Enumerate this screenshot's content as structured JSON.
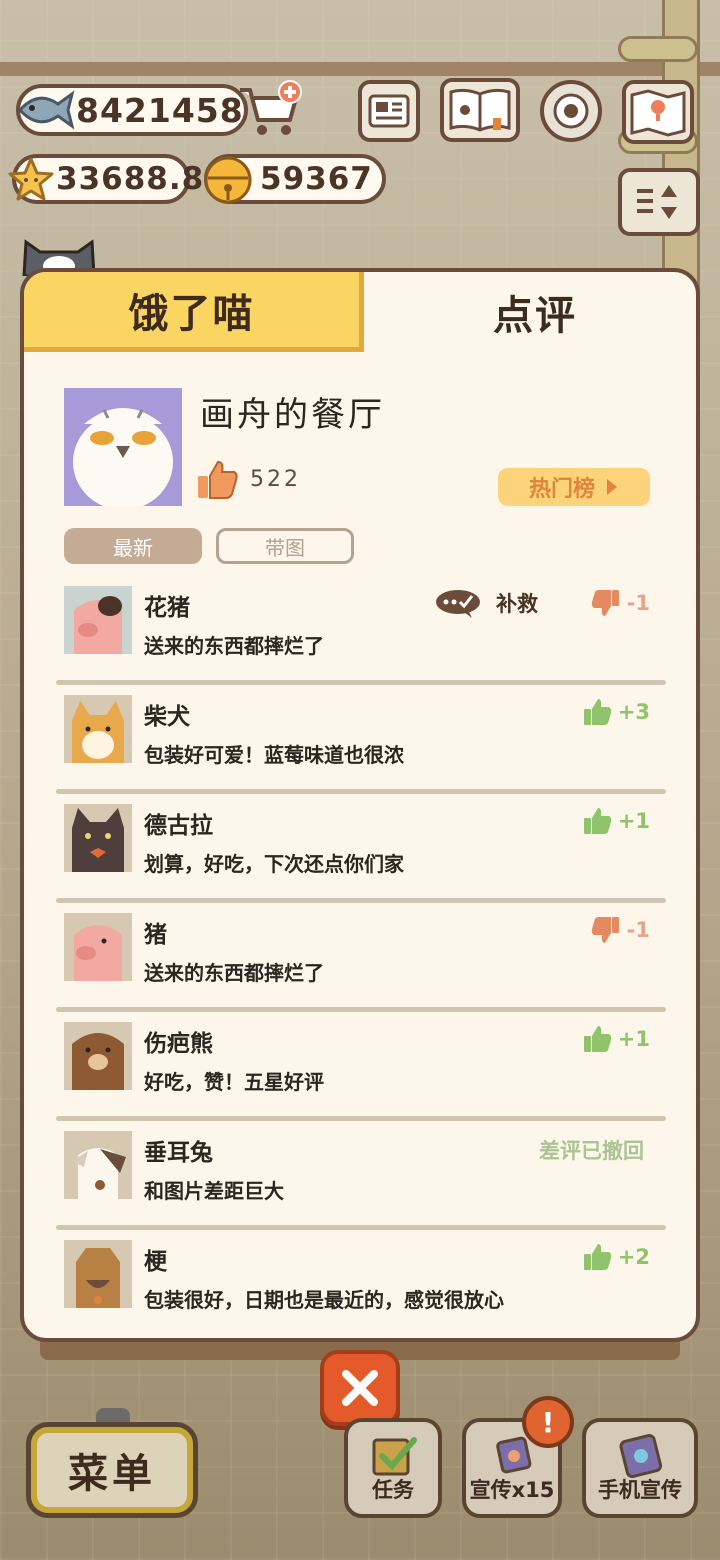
{
  "hud": {
    "fish_value": "8421458",
    "star_value": "33688.8",
    "bell_value": "59367"
  },
  "tabs": [
    {
      "label": "饿了喵",
      "active": true
    },
    {
      "label": "点评",
      "active": false
    }
  ],
  "profile": {
    "name": "画舟的餐厅",
    "likes": "522",
    "hot_button": "热门榜"
  },
  "filters": [
    {
      "label": "最新",
      "active": true
    },
    {
      "label": "带图",
      "active": false
    }
  ],
  "reviews": [
    {
      "name": "花猪",
      "text": "送来的东西都摔烂了",
      "score": "-1",
      "type": "down",
      "remedy": "补救",
      "avatar": "pig-spotted"
    },
    {
      "name": "柴犬",
      "text": "包装好可爱！蓝莓味道也很浓",
      "score": "+3",
      "type": "up",
      "avatar": "shiba"
    },
    {
      "name": "德古拉",
      "text": "划算，好吃，下次还点你们家",
      "score": "+1",
      "type": "up",
      "avatar": "dracula-cat"
    },
    {
      "name": "猪",
      "text": "送来的东西都摔烂了",
      "score": "-1",
      "type": "down",
      "avatar": "pig"
    },
    {
      "name": "伤疤熊",
      "text": "好吃，赞！五星好评",
      "score": "+1",
      "type": "up",
      "avatar": "bear"
    },
    {
      "name": "垂耳兔",
      "text": "和图片差距巨大",
      "status": "差评已撤回",
      "type": "status",
      "avatar": "lop-rabbit"
    },
    {
      "name": "梗",
      "text": "包装很好，日期也是最近的，感觉很放心",
      "score": "+2",
      "type": "up",
      "avatar": "terrier"
    }
  ],
  "bottom": {
    "menu_label": "菜单",
    "task_label": "任务",
    "promo_label": "宣传x15",
    "phone_promo_label": "手机宣传",
    "badge": "!"
  },
  "colors": {
    "accent_yellow": "#fbd562",
    "border_brown": "#6b4c3b",
    "like_green": "#8fc46c",
    "dislike_orange": "#e3a68a",
    "close_red": "#e55a2a"
  }
}
